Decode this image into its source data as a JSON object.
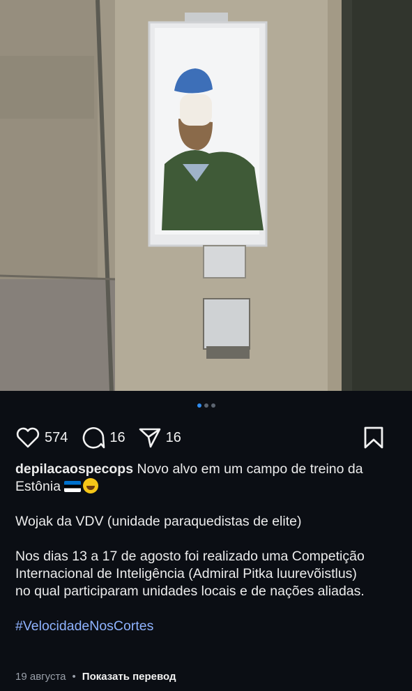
{
  "post": {
    "likes": "574",
    "comments": "16",
    "shares": "16",
    "username": "depilacaospecops",
    "caption_line1": "Novo alvo em um campo de treino da",
    "caption_line1b": "Estônia",
    "paragraph2": "Wojak da VDV (unidade paraquedistas de elite)",
    "paragraph3_line1": "Nos dias 13 a 17 de agosto foi realizado uma Competição",
    "paragraph3_line2": "Internacional de Inteligência (Admiral Pitka luurevõistlus)",
    "paragraph3_line3": "no qual participaram unidades locais e de nações aliadas.",
    "hashtag": "#VelocidadeNosCortes",
    "date": "19 августа",
    "separator": "•",
    "translate_label": "Показать перевод"
  },
  "carousel": {
    "total": 3,
    "active_index": 0
  },
  "icons": {
    "like": "heart-icon",
    "comment": "comment-icon",
    "share": "send-icon",
    "save": "bookmark-icon",
    "flag": "estonia-flag-emoji",
    "laugh": "rolling-laughing-emoji"
  },
  "colors": {
    "background": "#0b0e14",
    "text": "#f2f2f2",
    "hashtag": "#8fb3ff",
    "dot_active": "#2f8cf0",
    "dot_inactive": "#5c6470"
  }
}
